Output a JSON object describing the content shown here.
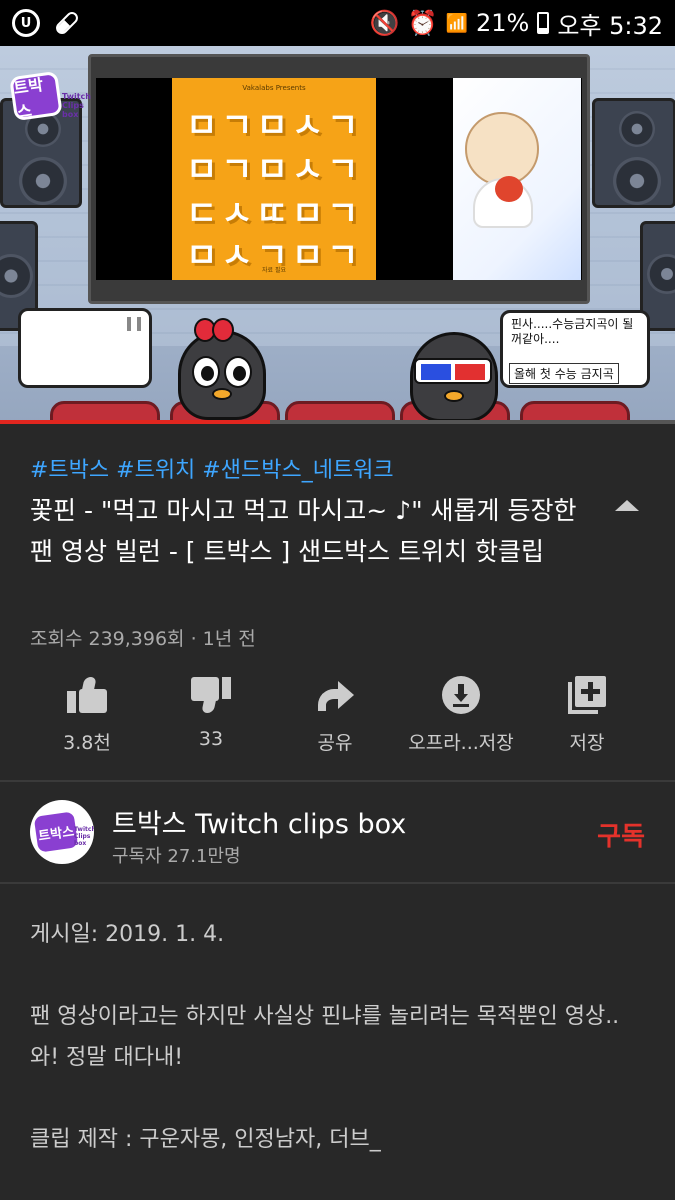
{
  "status_bar": {
    "battery": "21%",
    "time": "오후 5:32"
  },
  "video": {
    "poster_presents": "Vakalabs Presents",
    "poster_rows": [
      "ㅁㄱㅁㅅㄱ",
      "ㅁㄱㅁㅅㄱ",
      "ㄷㅅㄸㅁㄱ",
      "ㅁㅅㄱㅁㄱ"
    ],
    "poster_footer": "자료 필요",
    "right_bubble_text": "핀사.....수능금지곡이 될\n꺼같아....",
    "right_bubble_tag": "올해 첫 수능 금지곡",
    "progress_fraction": 0.4
  },
  "info": {
    "tags": "#트박스 #트위치 #샌드박스_네트워크",
    "title": "꽃핀 - \"먹고 마시고 먹고 마시고~ ♪\" 새롭게 등장한 팬 영상 빌런 - [ 트박스 ] 샌드박스 트위치 핫클립",
    "meta": "조회수 239,396회 · 1년 전"
  },
  "actions": {
    "like": "3.8천",
    "dislike": "33",
    "share": "공유",
    "offline": "오프라...저장",
    "save": "저장"
  },
  "channel": {
    "name": "트박스 Twitch clips box",
    "subscribers": "구독자 27.1만명",
    "subscribe_label": "구독",
    "logo_text": "트박스",
    "logo_sub": "Twitch Clips box"
  },
  "description": {
    "date": "게시일: 2019. 1. 4.",
    "line1": "팬 영상이라고는 하지만 사실상 핀냐를 놀리려는 목적뿐인 영상..",
    "line2": "와! 정말 대다내!",
    "line3": "클립 제작 : 구운자몽, 인정남자, 더브_"
  }
}
